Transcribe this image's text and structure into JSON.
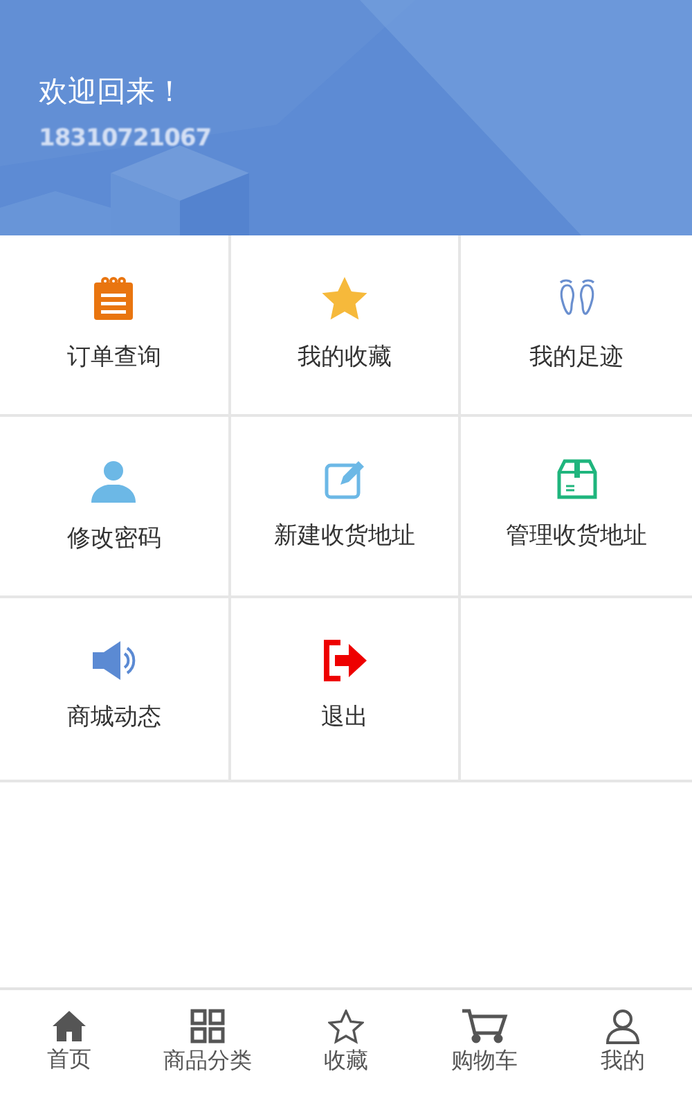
{
  "header": {
    "greeting": "欢迎回来！",
    "phone": "18310721067"
  },
  "menu": [
    {
      "label": "订单查询"
    },
    {
      "label": "我的收藏"
    },
    {
      "label": "我的足迹"
    },
    {
      "label": "修改密码"
    },
    {
      "label": "新建收货地址"
    },
    {
      "label": "管理收货地址"
    },
    {
      "label": "商城动态"
    },
    {
      "label": "退出"
    }
  ],
  "tab_bar": [
    {
      "label": "首页"
    },
    {
      "label": "商品分类"
    },
    {
      "label": "收藏"
    },
    {
      "label": "购物车"
    },
    {
      "label": "我的"
    }
  ]
}
